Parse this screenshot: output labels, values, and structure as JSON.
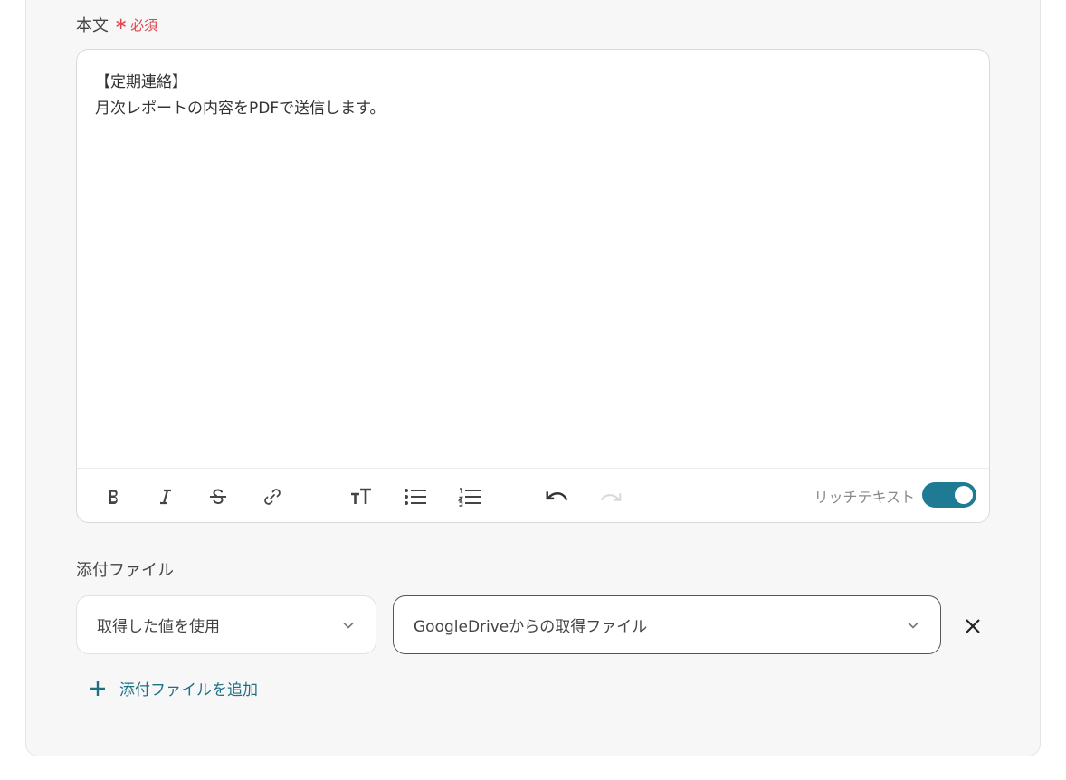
{
  "body_field": {
    "label": "本文",
    "required_text": "必須",
    "lines": [
      "【定期連絡】",
      "月次レポートの内容をPDFで送信します。"
    ]
  },
  "toolbar": {
    "icons": [
      "bold-icon",
      "italic-icon",
      "strikethrough-icon",
      "link-icon",
      "text-size-icon",
      "bullet-list-icon",
      "numbered-list-icon",
      "undo-icon",
      "redo-icon"
    ],
    "rich_text_label": "リッチテキスト",
    "rich_text_enabled": true
  },
  "attachment": {
    "label": "添付ファイル",
    "mode_select": {
      "value": "取得した値を使用"
    },
    "file_select": {
      "value": "GoogleDriveからの取得ファイル"
    },
    "add_label": "添付ファイルを追加"
  },
  "colors": {
    "accent": "#1f7a93",
    "required": "#e0454f",
    "link": "#1f6f86"
  }
}
